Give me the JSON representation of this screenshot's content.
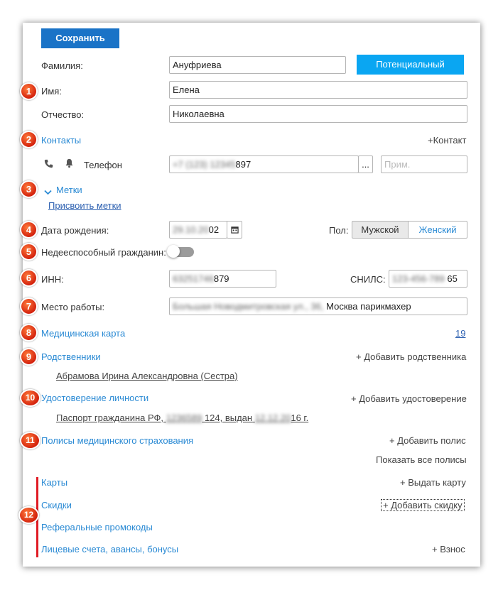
{
  "toolbar": {
    "save_label": "Сохранить",
    "status_label": "Потенциальный"
  },
  "fields": {
    "last_name_label": "Фамилия:",
    "last_name_value": "Ануфриева",
    "first_name_label": "Имя:",
    "first_name_value": "Елена",
    "middle_name_label": "Отчество:",
    "middle_name_value": "Николаевна"
  },
  "contacts": {
    "title": "Контакты",
    "add_label": "+Контакт",
    "phone_label": "Телефон",
    "phone_hidden": "+7 (123) 12345",
    "phone_visible": "897",
    "more_label": "...",
    "note_placeholder": "Прим."
  },
  "tags": {
    "title": "Метки",
    "assign_label": "Присвоить метки"
  },
  "birth": {
    "label": "Дата рождения:",
    "date_hidden": "29.10.20",
    "date_visible": "02",
    "gender_label": "Пол:",
    "gender_male": "Мужской",
    "gender_female": "Женский"
  },
  "incapable": {
    "label": "Недееспособный гражданин:"
  },
  "ids": {
    "inn_label": "ИНН:",
    "inn_hidden": "63251746",
    "inn_visible": "879",
    "snils_label": "СНИЛС:",
    "snils_hidden": "123-456-789",
    "snils_visible": "65"
  },
  "work": {
    "label": "Место работы:",
    "hidden": "Большая Новодмитровская ул., 36,",
    "visible": "Москва парикмахер"
  },
  "medcard": {
    "title": "Медицинская карта",
    "number": "19"
  },
  "relatives": {
    "title": "Родственники",
    "add_label": "+ Добавить родственника",
    "item": "Абрамова Ирина Александровна (Сестра)"
  },
  "identity": {
    "title": "Удостоверение личности",
    "add_label": "+ Добавить удостоверение",
    "doc_a": "Паспорт гражданина РФ,",
    "doc_b": "1236589",
    "doc_c": "124, выдан",
    "doc_d": "12.12.20",
    "doc_e": "16 г."
  },
  "policies": {
    "title": "Полисы медицинского страхования",
    "add_label": "+ Добавить полис",
    "show_all": "Показать все полисы"
  },
  "cards": {
    "title": "Карты",
    "add_label": "+ Выдать карту"
  },
  "discounts": {
    "title": "Скидки",
    "add_label": "+ Добавить скидку"
  },
  "promo": {
    "title": "Реферальные промокоды"
  },
  "accounts": {
    "title": "Лицевые счета, авансы, бонусы",
    "add_label": "+ Взнос"
  },
  "badges": [
    "1",
    "2",
    "3",
    "4",
    "5",
    "6",
    "7",
    "8",
    "9",
    "10",
    "11",
    "12"
  ],
  "colors": {
    "accent": "#1a73c7",
    "status": "#0aa6f2",
    "link": "#2a8ad4",
    "badge": "#e0401c",
    "marker": "#e01b24"
  }
}
